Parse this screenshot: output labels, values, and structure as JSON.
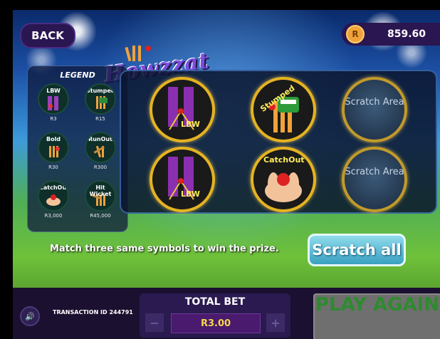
{
  "header": {
    "back_label": "BACK",
    "balance": "859.60",
    "coin_symbol": "R",
    "logo_text": "Howzzat"
  },
  "legend": {
    "title": "LEGEND",
    "items": [
      {
        "label": "LBW",
        "prize": "R3",
        "icon": "lbw-icon"
      },
      {
        "label": "Stumped",
        "prize": "R15",
        "icon": "stumped-icon"
      },
      {
        "label": "Bold",
        "prize": "R30",
        "icon": "bold-icon"
      },
      {
        "label": "RunOut",
        "prize": "R300",
        "icon": "runout-icon"
      },
      {
        "label": "CatchOut",
        "prize": "R3,000",
        "icon": "catchout-icon"
      },
      {
        "label": "Hit Wicket",
        "prize": "R45,000",
        "icon": "hit-wicket-icon"
      }
    ]
  },
  "board": {
    "cells": [
      {
        "state": "revealed",
        "symbol": "LBW",
        "label": "LBW"
      },
      {
        "state": "revealed",
        "symbol": "Stumped",
        "label": "Stumped"
      },
      {
        "state": "hidden",
        "text": "Scratch Area"
      },
      {
        "state": "revealed",
        "symbol": "LBW",
        "label": "LBW"
      },
      {
        "state": "revealed",
        "symbol": "CatchOut",
        "label": "CatchOut"
      },
      {
        "state": "hidden",
        "text": "Scratch Area"
      }
    ]
  },
  "instruction": "Match three same symbols to win the prize.",
  "scratch_all_label": "Scratch all",
  "footer": {
    "transaction": "TRANSACTION ID 244791",
    "total_bet_label": "TOTAL BET",
    "bet_value": "R3.00",
    "minus": "−",
    "plus": "+",
    "play_again_label": "PLAY AGAIN"
  },
  "colors": {
    "cell_border": "#e5b321",
    "symbol_label": "#ffef5a",
    "bet_value": "#f4d64a",
    "play_again_text": "#2f8a2f"
  }
}
